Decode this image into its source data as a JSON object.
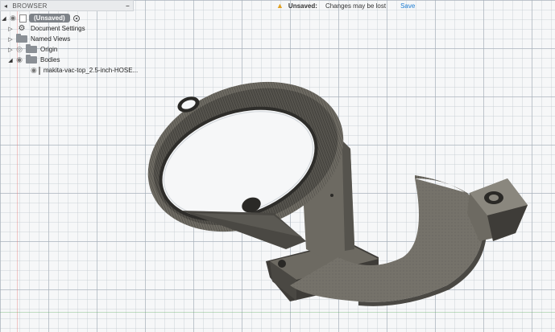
{
  "browser": {
    "header": "BROWSER",
    "root_label": "(Unsaved)",
    "items": [
      {
        "label": "Document Settings",
        "icon": "gear-icon"
      },
      {
        "label": "Named Views",
        "icon": "folder-icon"
      },
      {
        "label": "Origin",
        "icon": "folder-icon"
      },
      {
        "label": "Bodies",
        "icon": "folder-icon"
      }
    ],
    "body_item": {
      "label": "makita-vac-top_2.5-inch-HOSE..."
    }
  },
  "banner": {
    "title": "Unsaved:",
    "message": "Changes may be lost",
    "save_label": "Save"
  },
  "colors": {
    "model": "#6d6a62",
    "model_dark": "#3e3c38",
    "model_light": "#8a877e",
    "grid": "#a0aab4",
    "link": "#1b7bd1",
    "warning": "#e0a020"
  }
}
